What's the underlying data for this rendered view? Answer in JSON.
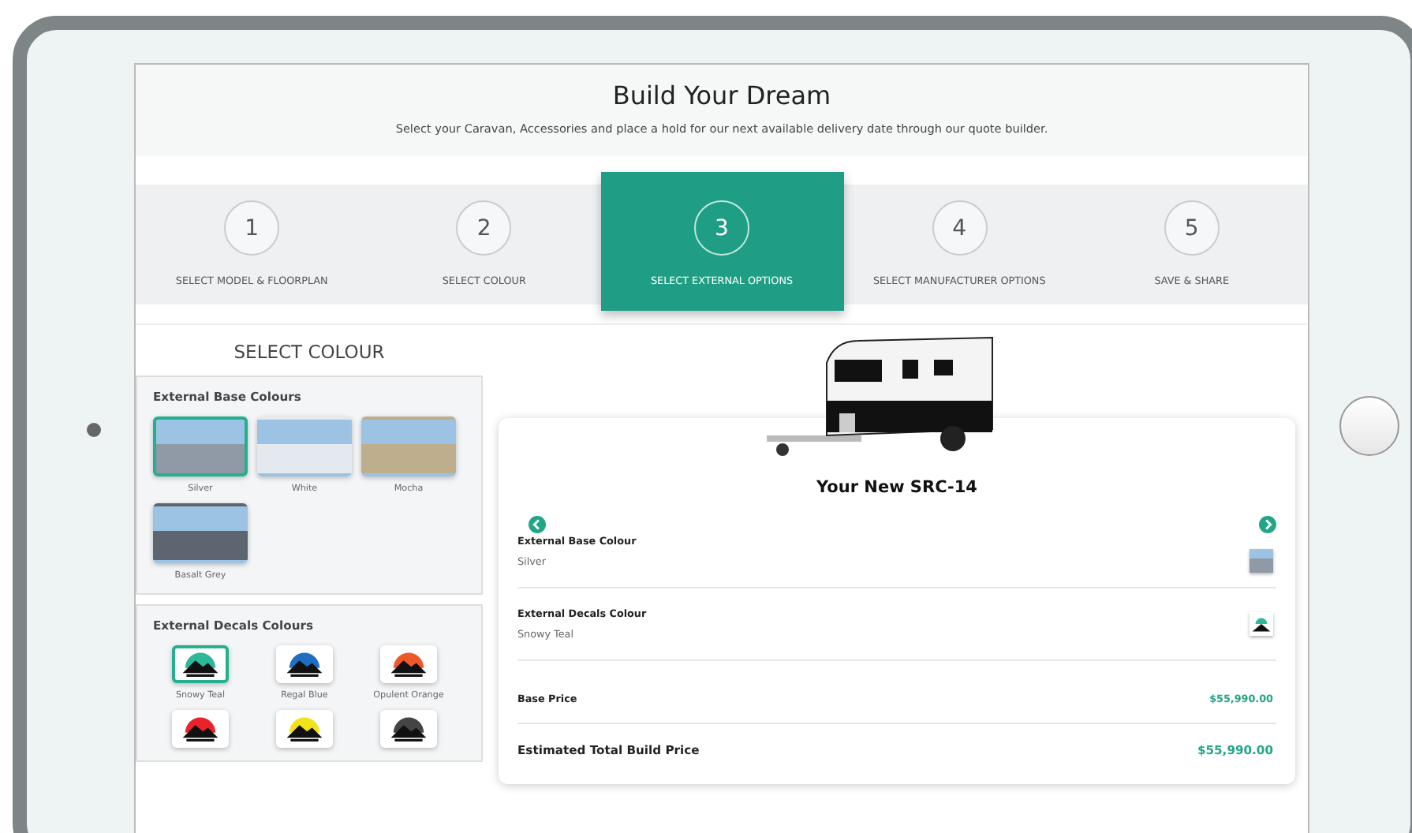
{
  "header": {
    "title": "Build Your Dream",
    "subtitle": "Select your Caravan, Accessories and place a hold for our next available delivery date through our quote builder."
  },
  "steps": [
    {
      "number": "1",
      "label": "SELECT MODEL & FLOORPLAN",
      "selected": false
    },
    {
      "number": "2",
      "label": "SELECT COLOUR",
      "selected": false
    },
    {
      "number": "3",
      "label": "SELECT EXTERNAL OPTIONS",
      "selected": true
    },
    {
      "number": "4",
      "label": "SELECT MANUFACTURER OPTIONS",
      "selected": false
    },
    {
      "number": "5",
      "label": "SAVE & SHARE",
      "selected": false
    }
  ],
  "sidebar": {
    "title": "SELECT COLOUR",
    "groups": [
      {
        "title": "External Base Colours",
        "kind": "photo",
        "options": [
          {
            "label": "Silver",
            "color": "#8f9aa6",
            "selected": true
          },
          {
            "label": "White",
            "color": "#e4e9ef",
            "selected": false
          },
          {
            "label": "Mocha",
            "color": "#bfae8e",
            "selected": false
          },
          {
            "label": "Basalt Grey",
            "color": "#5d6670",
            "selected": false
          }
        ]
      },
      {
        "title": "External Decals Colours",
        "kind": "logo",
        "options": [
          {
            "label": "Snowy Teal",
            "color": "#2fb79a",
            "selected": true
          },
          {
            "label": "Regal Blue",
            "color": "#1f6fc0",
            "selected": false
          },
          {
            "label": "Opulent Orange",
            "color": "#ec5a2a",
            "selected": false
          },
          {
            "color": "#e8232b",
            "selected": false
          },
          {
            "color": "#f2e21c",
            "selected": false
          },
          {
            "color": "#444444",
            "selected": false
          }
        ]
      }
    ]
  },
  "summary": {
    "title": "Your New SRC-14",
    "items": [
      {
        "label": "External Base Colour",
        "value": "Silver",
        "kind": "photo",
        "color": "#8f9aa6"
      },
      {
        "label": "External Decals Colour",
        "value": "Snowy Teal",
        "kind": "logo",
        "color": "#2fb79a"
      }
    ],
    "base_price": {
      "label": "Base Price",
      "value": "$55,990.00"
    },
    "total": {
      "label": "Estimated Total Build Price",
      "value": "$55,990.00"
    }
  }
}
